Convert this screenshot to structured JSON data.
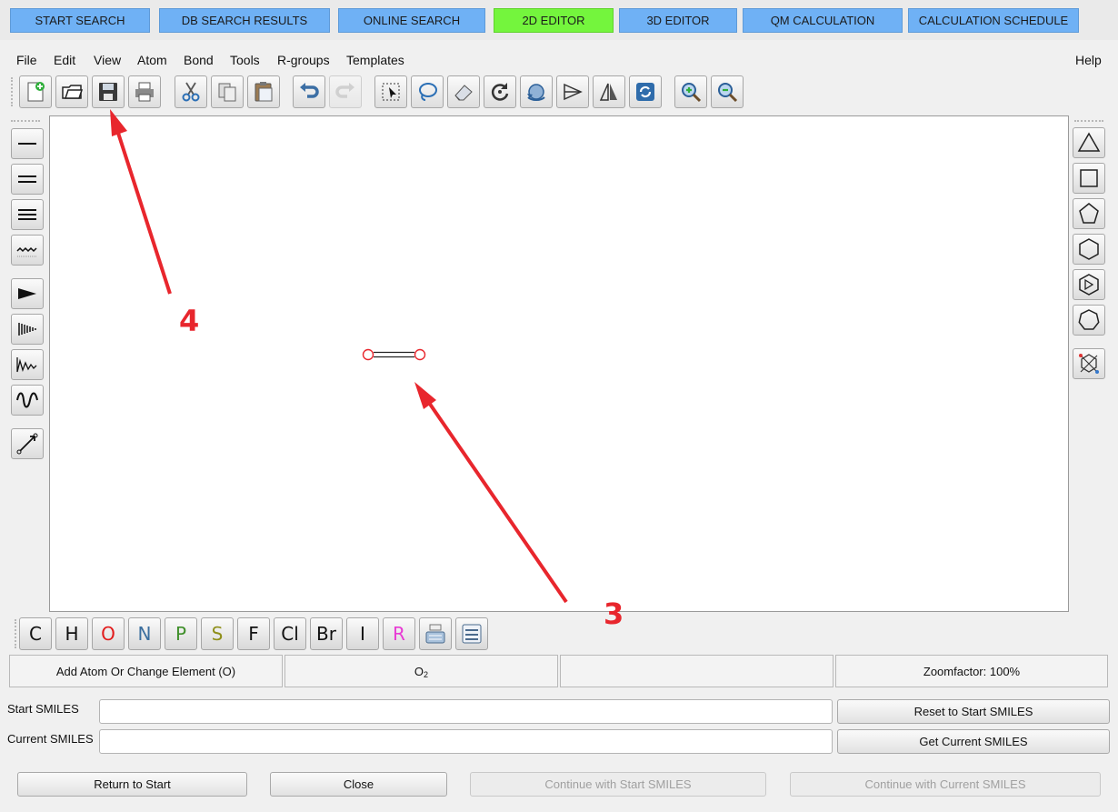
{
  "tabs": [
    {
      "label": "START SEARCH"
    },
    {
      "label": "DB SEARCH RESULTS"
    },
    {
      "label": "ONLINE SEARCH"
    },
    {
      "label": "2D EDITOR",
      "active": true
    },
    {
      "label": "3D EDITOR"
    },
    {
      "label": "QM CALCULATION"
    },
    {
      "label": "CALCULATION SCHEDULE"
    }
  ],
  "menu": {
    "items": [
      "File",
      "Edit",
      "View",
      "Atom",
      "Bond",
      "Tools",
      "R-groups",
      "Templates"
    ],
    "help": "Help"
  },
  "toolbar": {
    "buttons": [
      {
        "icon": "new-icon"
      },
      {
        "icon": "open-icon"
      },
      {
        "icon": "save-icon"
      },
      {
        "icon": "print-icon"
      },
      {
        "icon": "cut-icon"
      },
      {
        "icon": "copy-icon"
      },
      {
        "icon": "paste-icon"
      },
      {
        "icon": "undo-icon"
      },
      {
        "icon": "redo-icon",
        "disabled": true
      },
      {
        "icon": "select-icon"
      },
      {
        "icon": "lasso-icon"
      },
      {
        "icon": "eraser-icon"
      },
      {
        "icon": "rotate-icon"
      },
      {
        "icon": "move-icon"
      },
      {
        "icon": "flip-horizontal-icon"
      },
      {
        "icon": "flip-vertical-icon"
      },
      {
        "icon": "clean-icon"
      },
      {
        "icon": "zoom-in-icon"
      },
      {
        "icon": "zoom-out-icon"
      }
    ]
  },
  "left_tools": [
    "single-bond-icon",
    "double-bond-icon",
    "triple-bond-icon",
    "any-bond-icon",
    "wedge-bond-icon",
    "hash-bond-icon",
    "wavy-bond-icon",
    "curly-bond-icon",
    "chain-icon"
  ],
  "right_tools": [
    "cyclopropane-icon",
    "cyclobutane-icon",
    "cyclopentane-icon",
    "cyclohexane-icon",
    "benzene-icon",
    "cycloheptane-icon",
    "template-icon"
  ],
  "molecule": {
    "atom1": "O",
    "atom2": "O",
    "color": "#e8262d"
  },
  "elements": [
    {
      "symbol": "C",
      "color": "#111111"
    },
    {
      "symbol": "H",
      "color": "#111111"
    },
    {
      "symbol": "O",
      "color": "#e21b1b"
    },
    {
      "symbol": "N",
      "color": "#3b6e9e"
    },
    {
      "symbol": "P",
      "color": "#3f8f2a"
    },
    {
      "symbol": "S",
      "color": "#8f8f1a"
    },
    {
      "symbol": "F",
      "color": "#111111"
    },
    {
      "symbol": "Cl",
      "color": "#111111"
    },
    {
      "symbol": "Br",
      "color": "#111111"
    },
    {
      "symbol": "I",
      "color": "#111111"
    },
    {
      "symbol": "R",
      "color": "#e83ad4"
    }
  ],
  "element_extra": [
    "periodic-table-icon",
    "element-list-icon"
  ],
  "status": {
    "mode": "Add Atom Or Change Element (O)",
    "formula_main": "O",
    "formula_sub": "2",
    "empty": "",
    "zoom": "Zoomfactor: 100%"
  },
  "smiles": {
    "start_label": "Start SMILES",
    "start_value": "",
    "current_label": "Current SMILES",
    "current_value": "",
    "reset_button": "Reset to Start SMILES",
    "get_button": "Get Current SMILES"
  },
  "footer": {
    "return": "Return to Start",
    "close": "Close",
    "continue_start": "Continue with Start SMILES",
    "continue_current": "Continue with Current SMILES"
  },
  "annotations": [
    {
      "label": "4"
    },
    {
      "label": "3"
    }
  ],
  "colors": {
    "tab": "#6fb1f5",
    "tab_active": "#74f53d",
    "annotation": "#e8262d"
  }
}
